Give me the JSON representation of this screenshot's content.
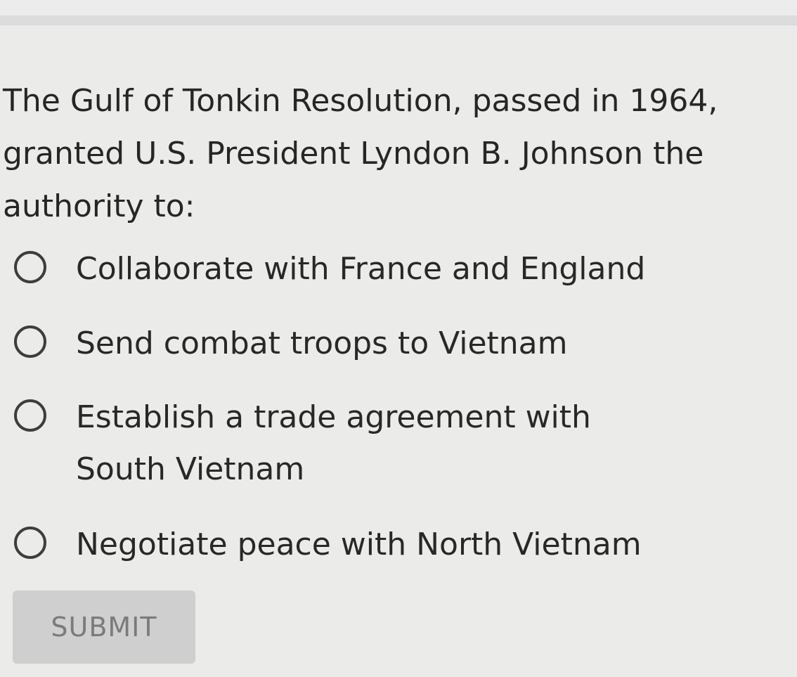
{
  "question": {
    "text": "The Gulf of Tonkin Resolution, passed in 1964, granted U.S. President Lyndon B. Johnson the authority to:"
  },
  "options": [
    {
      "label": "Collaborate with France and England",
      "selected": false
    },
    {
      "label": "Send combat troops to Vietnam",
      "selected": false
    },
    {
      "label": "Establish a trade agreement with South Vietnam",
      "selected": false
    },
    {
      "label": "Negotiate peace with North Vietnam",
      "selected": false
    }
  ],
  "submit": {
    "label": "SUBMIT",
    "enabled": false
  },
  "colors": {
    "background": "#ebebe9",
    "text": "#262626",
    "radio_border": "#3d3d3d",
    "submit_bg": "#cfcfcf",
    "submit_text": "#7b7b7b"
  }
}
